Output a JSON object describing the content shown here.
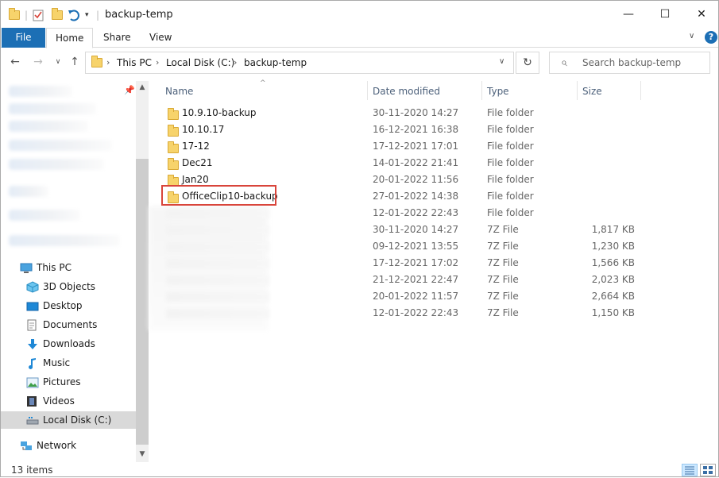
{
  "window": {
    "title": "backup-temp",
    "minimize": "—",
    "maximize": "☐",
    "close": "✕"
  },
  "ribbon": {
    "tabs": [
      {
        "label": "File"
      },
      {
        "label": "Home"
      },
      {
        "label": "Share"
      },
      {
        "label": "View"
      }
    ],
    "expand_icon": "chevron-down-icon",
    "help": "?"
  },
  "address": {
    "crumbs": [
      "This PC",
      "Local Disk (C:)",
      "backup-temp"
    ],
    "search_placeholder": "Search backup-temp"
  },
  "nav": {
    "items": [
      {
        "label": "This PC",
        "icon": "computer-icon"
      },
      {
        "label": "3D Objects",
        "icon": "cube-icon"
      },
      {
        "label": "Desktop",
        "icon": "desktop-icon"
      },
      {
        "label": "Documents",
        "icon": "documents-icon"
      },
      {
        "label": "Downloads",
        "icon": "download-arrow-icon"
      },
      {
        "label": "Music",
        "icon": "music-note-icon"
      },
      {
        "label": "Pictures",
        "icon": "pictures-icon"
      },
      {
        "label": "Videos",
        "icon": "film-icon"
      },
      {
        "label": "Local Disk (C:)",
        "icon": "drive-icon"
      },
      {
        "label": "Network",
        "icon": "network-icon"
      }
    ]
  },
  "columns": {
    "name": "Name",
    "date": "Date modified",
    "type": "Type",
    "size": "Size"
  },
  "files": [
    {
      "name": "10.9.10-backup",
      "date": "30-11-2020 14:27",
      "type": "File folder",
      "size": ""
    },
    {
      "name": "10.10.17",
      "date": "16-12-2021 16:38",
      "type": "File folder",
      "size": ""
    },
    {
      "name": "17-12",
      "date": "17-12-2021 17:01",
      "type": "File folder",
      "size": ""
    },
    {
      "name": "Dec21",
      "date": "14-01-2022 21:41",
      "type": "File folder",
      "size": ""
    },
    {
      "name": "Jan20",
      "date": "20-01-2022 11:56",
      "type": "File folder",
      "size": ""
    },
    {
      "name": "OfficeClip10-backup",
      "date": "27-01-2022 14:38",
      "type": "File folder",
      "size": ""
    },
    {
      "name": "",
      "date": "12-01-2022 22:43",
      "type": "File folder",
      "size": ""
    },
    {
      "name": "",
      "date": "30-11-2020 14:27",
      "type": "7Z File",
      "size": "1,817 KB"
    },
    {
      "name": "",
      "date": "09-12-2021 13:55",
      "type": "7Z File",
      "size": "1,230 KB"
    },
    {
      "name": "",
      "date": "17-12-2021 17:02",
      "type": "7Z File",
      "size": "1,566 KB"
    },
    {
      "name": "",
      "date": "21-12-2021 22:47",
      "type": "7Z File",
      "size": "2,023 KB"
    },
    {
      "name": "",
      "date": "20-01-2022 11:57",
      "type": "7Z File",
      "size": "2,664 KB"
    },
    {
      "name": "",
      "date": "12-01-2022 22:43",
      "type": "7Z File",
      "size": "1,150 KB"
    }
  ],
  "status": {
    "count": "13 items"
  },
  "colors": {
    "file_tab": "#1c6fb5",
    "highlight_border": "#d9453b",
    "folder": "#f7d36b",
    "selected_nav": "#d9d9d9"
  }
}
